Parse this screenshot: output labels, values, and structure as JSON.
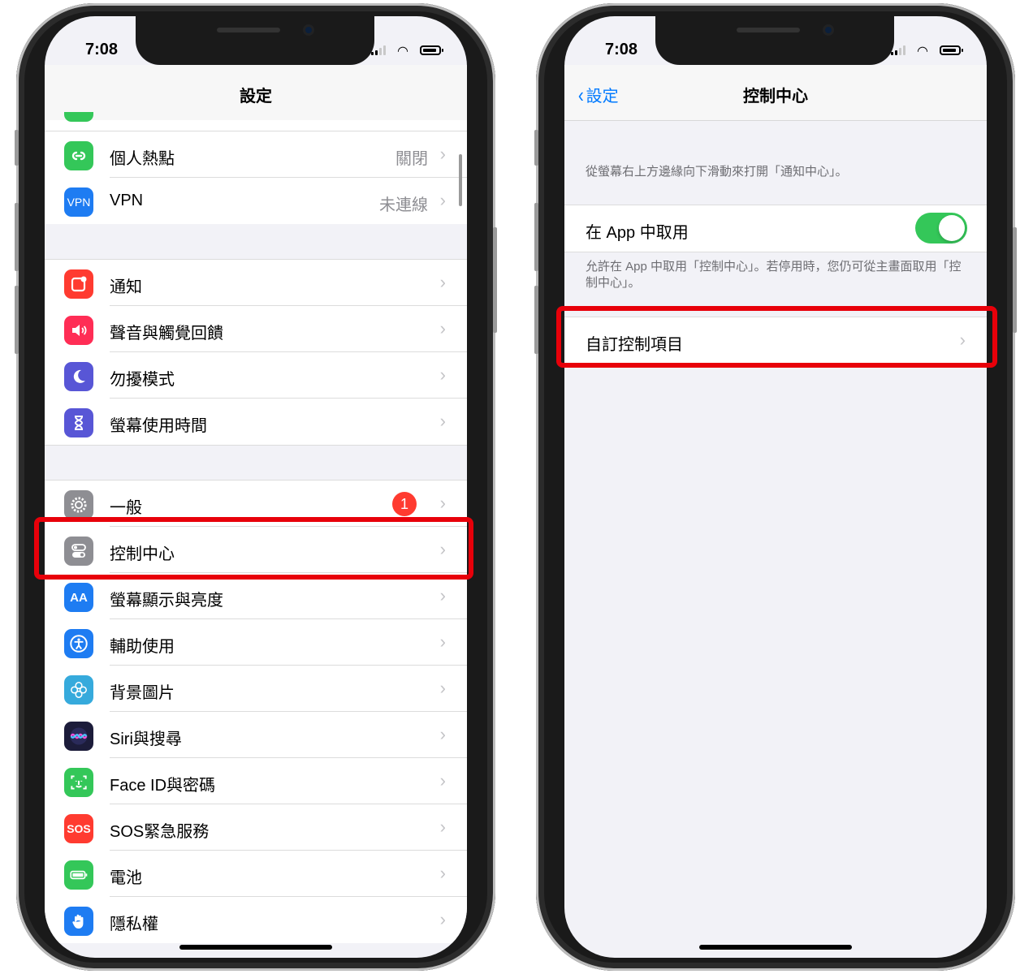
{
  "colors": {
    "accent": "#007aff",
    "highlight": "#e8000a",
    "toggle_on": "#34c759",
    "badge": "#ff3b30"
  },
  "left_phone": {
    "time": "7:08",
    "nav_title": "設定",
    "group1": [
      {
        "label": "個人熱點",
        "value": "關閉",
        "icon": "hotspot-icon",
        "color": "#34c759"
      },
      {
        "label": "VPN",
        "value": "未連線",
        "icon": "vpn-icon",
        "icon_text": "VPN",
        "color": "#1e7cf2"
      }
    ],
    "group2": [
      {
        "label": "通知",
        "icon": "notifications-icon",
        "color": "#ff3b30"
      },
      {
        "label": "聲音與觸覺回饋",
        "icon": "sound-icon",
        "color": "#ff2d55"
      },
      {
        "label": "勿擾模式",
        "icon": "moon-icon",
        "color": "#5856d6"
      },
      {
        "label": "螢幕使用時間",
        "icon": "hourglass-icon",
        "color": "#5856d6"
      }
    ],
    "group3": [
      {
        "label": "一般",
        "icon": "gear-icon",
        "color": "#8e8e93",
        "badge": "1"
      },
      {
        "label": "控制中心",
        "icon": "control-center-icon",
        "color": "#8e8e93"
      },
      {
        "label": "螢幕顯示與亮度",
        "icon": "display-icon",
        "icon_text": "AA",
        "color": "#1e7cf2"
      },
      {
        "label": "輔助使用",
        "icon": "accessibility-icon",
        "color": "#1e7cf2"
      },
      {
        "label": "背景圖片",
        "icon": "wallpaper-icon",
        "color": "#36aadc"
      },
      {
        "label": "Siri與搜尋",
        "icon": "siri-icon",
        "color": "#1c1c3a"
      },
      {
        "label": "Face ID與密碼",
        "icon": "faceid-icon",
        "color": "#34c759"
      },
      {
        "label": "SOS緊急服務",
        "icon": "sos-icon",
        "icon_text": "SOS",
        "color": "#ff3b30"
      },
      {
        "label": "電池",
        "icon": "battery-icon",
        "color": "#34c759"
      },
      {
        "label": "隱私權",
        "icon": "hand-icon",
        "color": "#1e7cf2"
      }
    ]
  },
  "right_phone": {
    "time": "7:08",
    "back_label": "設定",
    "nav_title": "控制中心",
    "intro": "從螢幕右上方邊緣向下滑動來打開「通知中心」。",
    "toggle_label": "在 App 中取用",
    "toggle_on": true,
    "toggle_desc": "允許在 App 中取用「控制中心」。若停用時，您仍可從主畫面取用「控制中心」。",
    "customize_label": "自訂控制項目"
  }
}
